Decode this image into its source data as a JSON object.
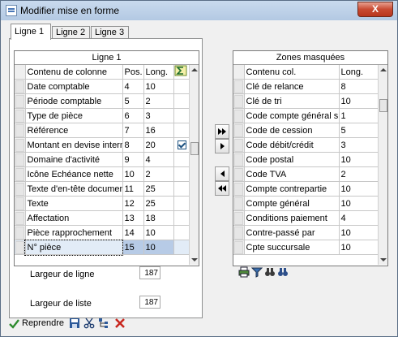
{
  "window": {
    "title": "Modifier mise en forme",
    "close_label": "X"
  },
  "tabs": [
    {
      "label": "Ligne 1"
    },
    {
      "label": "Ligne 2"
    },
    {
      "label": "Ligne 3"
    }
  ],
  "left_table": {
    "caption": "Ligne 1",
    "headers": {
      "name": "Contenu de colonne",
      "pos": "Pos.",
      "len": "Long."
    },
    "rows": [
      {
        "name": "Date comptable",
        "pos": "4",
        "len": "10"
      },
      {
        "name": "Période comptable",
        "pos": "5",
        "len": "2"
      },
      {
        "name": "Type de pièce",
        "pos": "6",
        "len": "3"
      },
      {
        "name": "Référence",
        "pos": "7",
        "len": "16"
      },
      {
        "name": "Montant en devise interne",
        "pos": "8",
        "len": "20",
        "checked": true
      },
      {
        "name": "Domaine d'activité",
        "pos": "9",
        "len": "4"
      },
      {
        "name": "Icône Echéance nette",
        "pos": "10",
        "len": "2"
      },
      {
        "name": "Texte d'en-tête document",
        "pos": "11",
        "len": "25"
      },
      {
        "name": "Texte",
        "pos": "12",
        "len": "25"
      },
      {
        "name": "Affectation",
        "pos": "13",
        "len": "18"
      },
      {
        "name": "Pièce rapprochement",
        "pos": "14",
        "len": "10"
      },
      {
        "name": "N° pièce",
        "pos": "15",
        "len": "10"
      }
    ]
  },
  "right_table": {
    "caption": "Zones masquées",
    "headers": {
      "name": "Contenu col.",
      "len": "Long."
    },
    "rows": [
      {
        "name": "Clé de relance",
        "len": "8"
      },
      {
        "name": "Clé de tri",
        "len": "10"
      },
      {
        "name": "Code compte général sp...",
        "len": "1"
      },
      {
        "name": "Code de cession",
        "len": "5"
      },
      {
        "name": "Code débit/crédit",
        "len": "3"
      },
      {
        "name": "Code postal",
        "len": "10"
      },
      {
        "name": "Code TVA",
        "len": "2"
      },
      {
        "name": "Compte contrepartie",
        "len": "10"
      },
      {
        "name": "Compte général",
        "len": "10"
      },
      {
        "name": "Conditions paiement",
        "len": "4"
      },
      {
        "name": "Contre-passé par",
        "len": "10"
      },
      {
        "name": "Cpte succursale",
        "len": "10"
      }
    ]
  },
  "line_width": {
    "label": "Largeur de ligne",
    "value": "187"
  },
  "list_width": {
    "label": "Largeur de liste",
    "value": "187"
  },
  "toolbar": {
    "reprendre_label": "Reprendre"
  },
  "colors": {
    "selection": "#b7cbe6",
    "title_bar": "#c9daee",
    "close": "#c84a32"
  }
}
